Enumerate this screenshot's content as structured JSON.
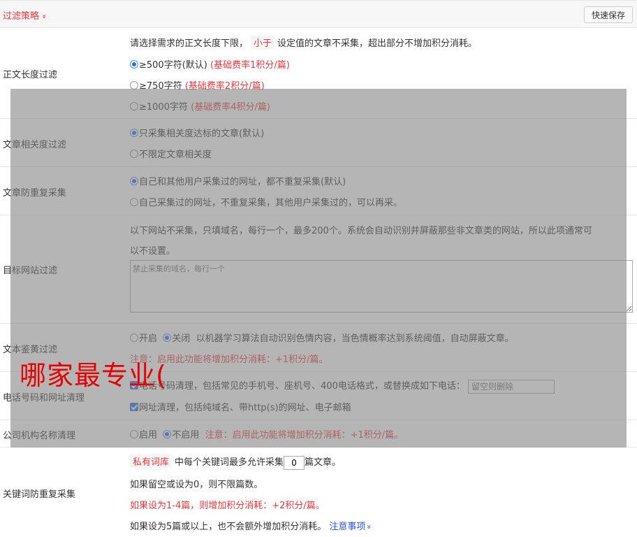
{
  "header": {
    "title": "过滤策略",
    "chevron": "»",
    "save_label": "快速保存"
  },
  "length_filter": {
    "label": "正文长度过滤",
    "desc_pre": "请选择需求的正文长度下限，",
    "desc_tag": "小于",
    "desc_post": "设定值的文章不采集，超出部分不增加积分消耗。",
    "options": [
      {
        "text": "≥500字符(默认)",
        "note": "(基础费率1积分/篇)"
      },
      {
        "text": "≥750字符",
        "note": "(基础费率2积分/篇)"
      },
      {
        "text": "≥1000字符",
        "note": "(基础费率4积分/篇)"
      }
    ]
  },
  "relevance": {
    "label": "文章相关度过滤",
    "options": [
      "只采集相关度达标的文章(默认)",
      "不限定文章相关度"
    ]
  },
  "dedup": {
    "label": "文章防重复采集",
    "options": [
      "自己和其他用户采集过的网址，都不重复采集(默认)",
      "自己采集过的网址，不重复采集，其他用户采集过的，可以再采。"
    ]
  },
  "site_filter": {
    "label": "目标网站过滤",
    "desc1": "以下网站不采集，只填域名，每行一个，最多200个。系统会自动识别并屏蔽那些非文章类的网站，所以此项通常可",
    "desc2": "以不设置。",
    "placeholder": "禁止采集的域名，每行一个"
  },
  "porn": {
    "label": "文本鉴黄过滤",
    "on": "开启",
    "off": "关闭",
    "desc": "以机器学习算法自动识别色情内容，当色情概率达到系统阈值，自动屏蔽文章。",
    "note": "注意：启用此功能将增加积分消耗：+1积分/篇。"
  },
  "phone": {
    "label": "电话号码和网址清理",
    "opt1": "电话号码清理，包括常见的手机号、座机号、400电话格式，或替换成如下电话：",
    "opt1_placeholder": "留空则删除",
    "opt2": "网址清理，包括纯域名、带http(s)的网址、电子邮箱"
  },
  "company": {
    "label": "公司机构名称清理",
    "on": "启用",
    "off": "不启用",
    "note": "注意：启用此功能将增加积分消耗：+1积分/篇。"
  },
  "keyword": {
    "label": "关键词防重复采集",
    "tag": "私有词库",
    "line1_pre": "中每个关键词最多允许采集",
    "value": "0",
    "line1_post": "篇文章。",
    "line2": "如果留空或设为0，则不限篇数。",
    "line3": "如果设为1-4篇，则增加积分消耗：+2积分/篇。",
    "line4": "如果设为5篇或以上，也不会额外增加积分消耗。",
    "link": "注意事项",
    "link_chevron": "»"
  },
  "watermark": "哪家最专业("
}
